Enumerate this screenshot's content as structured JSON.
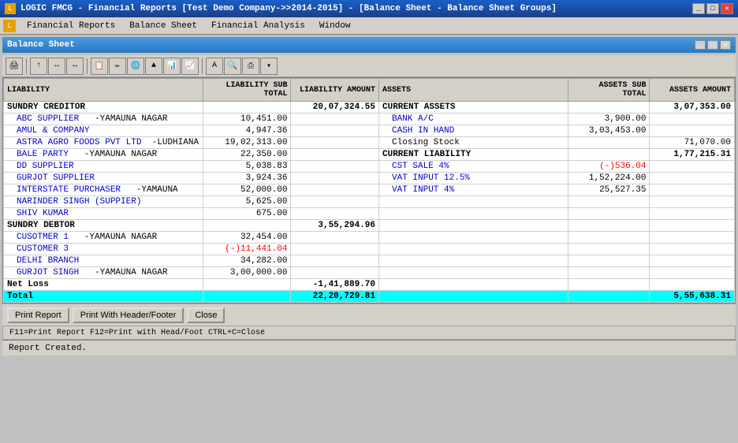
{
  "titleBar": {
    "title": "LOGIC FMCG - Financial Reports  [Test Demo Company->>2014-2015] - [Balance Sheet - Balance Sheet Groups]",
    "icon": "L"
  },
  "menuBar": {
    "icon": "L",
    "items": [
      "Financial Reports",
      "Balance Sheet",
      "Financial Analysis",
      "Window"
    ]
  },
  "innerTitle": {
    "title": "Balance Sheet"
  },
  "headers": {
    "liability": "LIABILITY",
    "liabilitySubTotal": "LIABILITY SUB TOTAL",
    "liabilityAmount": "LIABILITY AMOUNT",
    "assets": "ASSETS",
    "assetsSubTotal": "ASSETS SUB TOTAL",
    "assetsAmount": "ASSETS AMOUNT"
  },
  "liabilitySection1": {
    "header": "SUNDRY CREDITOR",
    "totalAmount": "20,07,324.55",
    "items": [
      {
        "name": "ABC SUPPLIER",
        "location": "-YAMAUNA NAGAR",
        "amount": "10,451.00"
      },
      {
        "name": "AMUL & COMPANY",
        "location": "",
        "amount": "4,947.36"
      },
      {
        "name": "ASTRA AGRO FOODS PVT LTD",
        "location": "-LUDHIANA",
        "amount": "19,02,313.00"
      },
      {
        "name": "BALE PARTY",
        "location": "-YAMAUNA NAGAR",
        "amount": "22,350.00"
      },
      {
        "name": "DD SUPPLIER",
        "location": "",
        "amount": "5,038.83"
      },
      {
        "name": "GURJOT SUPPLIER",
        "location": "",
        "amount": "3,924.36"
      },
      {
        "name": "INTERSTATE PURCHASER",
        "location": "-YAMAUNA",
        "amount": "52,000.00"
      },
      {
        "name": "NARINDER SINGH (SUPPIER)",
        "location": "",
        "amount": "5,625.00"
      },
      {
        "name": "SHIV KUMAR",
        "location": "",
        "amount": "675.00"
      }
    ]
  },
  "liabilitySection2": {
    "header": "SUNDRY DEBTOR",
    "totalAmount": "3,55,294.96",
    "items": [
      {
        "name": "CUSOTMER 1",
        "location": "-YAMAUNA NAGAR",
        "amount": "32,454.00",
        "negative": false
      },
      {
        "name": "CUSTOMER 3",
        "location": "",
        "amount": "(-)11,441.04",
        "negative": true
      },
      {
        "name": "DELHI BRANCH",
        "location": "",
        "amount": "34,282.00",
        "negative": false
      },
      {
        "name": "GURJOT SINGH",
        "location": "-YAMAUNA NAGAR",
        "amount": "3,00,000.00",
        "negative": false
      }
    ]
  },
  "netLoss": {
    "label": "Net Loss",
    "amount": "-1,41,889.70"
  },
  "totalRow": {
    "label": "Total",
    "liabilityAmount": "22,20,729.81",
    "assetsAmount": "5,55,638.31"
  },
  "assetsSection1": {
    "header": "CURRENT ASSETS",
    "totalAmount": "3,07,353.00",
    "items": [
      {
        "name": "BANK A/C",
        "subTotal": "3,900.00",
        "amount": ""
      },
      {
        "name": "CASH IN HAND",
        "subTotal": "3,03,453.00",
        "amount": ""
      },
      {
        "name": "Closing Stock",
        "subTotal": "",
        "amount": "71,070.00"
      }
    ]
  },
  "assetsSection2": {
    "header": "CURRENT LIABILITY",
    "totalAmount": "1,77,215.31",
    "items": [
      {
        "name": "CST SALE 4%",
        "subTotal": "(-)536.04",
        "amount": "",
        "negative": true
      },
      {
        "name": "VAT INPUT 12.5%",
        "subTotal": "1,52,224.00",
        "amount": ""
      },
      {
        "name": "VAT INPUT 4%",
        "subTotal": "25,527.35",
        "amount": ""
      }
    ]
  },
  "bottomButtons": {
    "printReport": "Print Report",
    "printWithHeader": "Print With Header/Footer",
    "close": "Close"
  },
  "shortcutText": "F11=Print Report  F12=Print with Head/Foot  CTRL+C=Close",
  "statusText": "Report Created."
}
